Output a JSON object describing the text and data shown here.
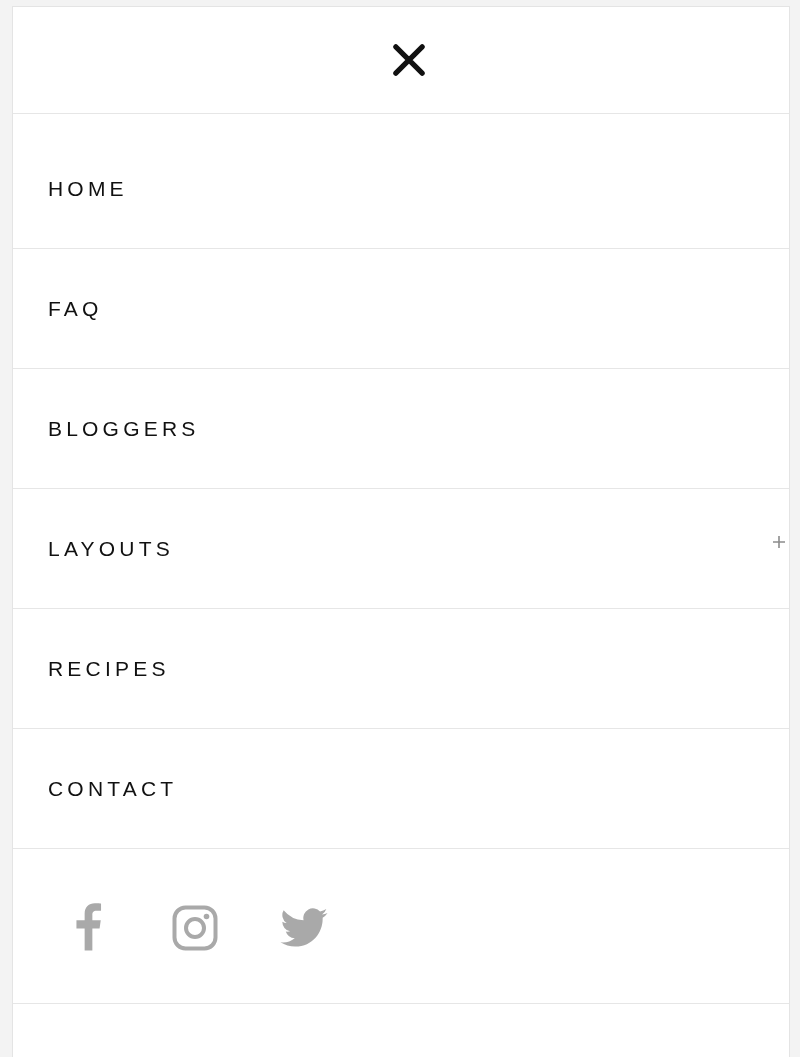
{
  "menu": {
    "items": [
      {
        "label": "HOME",
        "kind": "link"
      },
      {
        "label": "FAQ",
        "kind": "link"
      },
      {
        "label": "BLOGGERS",
        "kind": "link"
      },
      {
        "label": "LAYOUTS",
        "kind": "submenu"
      },
      {
        "label": "RECIPES",
        "kind": "link"
      },
      {
        "label": "CONTACT",
        "kind": "link"
      }
    ]
  },
  "social": [
    {
      "kind": "f"
    },
    {
      "kind": "camera"
    },
    {
      "kind": "bird"
    }
  ]
}
